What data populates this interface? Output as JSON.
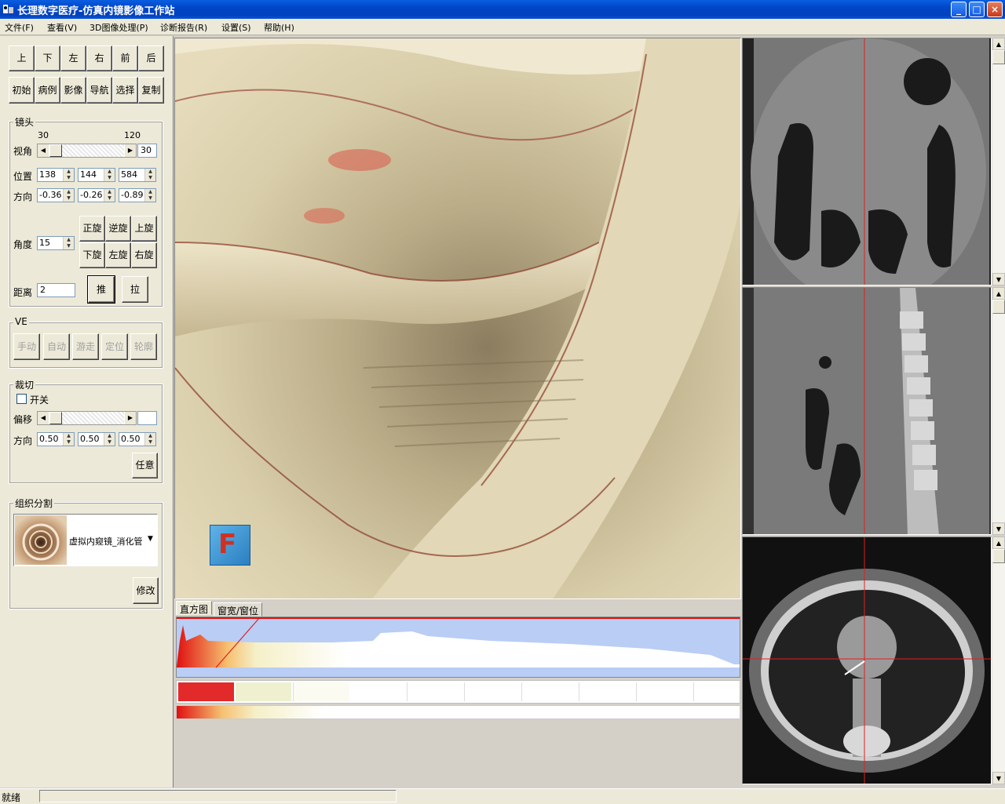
{
  "window": {
    "title": "长理数字医疗-仿真内镜影像工作站",
    "min": "_",
    "max": "□",
    "close": "×"
  },
  "menu": [
    "文件(F)",
    "查看(V)",
    "3D图像处理(P)",
    "诊断报告(R)",
    "设置(S)",
    "帮助(H)"
  ],
  "dir_buttons": [
    "上",
    "下",
    "左",
    "右",
    "前",
    "后"
  ],
  "action_buttons": [
    "初始",
    "病例",
    "影像",
    "导航",
    "选择",
    "复制"
  ],
  "lens": {
    "title": "镜头",
    "fov_min": "30",
    "fov_max": "120",
    "fov_label": "视角",
    "fov_value": "30",
    "pos_label": "位置",
    "pos": [
      "138",
      "144",
      "584"
    ],
    "dir_label": "方向",
    "dir": [
      "-0.36",
      "-0.26",
      "-0.89"
    ],
    "angle_label": "角度",
    "angle_value": "15",
    "rot_buttons": [
      "正旋",
      "逆旋",
      "上旋",
      "下旋",
      "左旋",
      "右旋"
    ],
    "dist_label": "距离",
    "dist_value": "2",
    "push": "推",
    "pull": "拉"
  },
  "ve": {
    "title": "VE",
    "buttons": [
      "手动",
      "自动",
      "游走",
      "定位",
      "轮廓"
    ]
  },
  "clip": {
    "title": "裁切",
    "switch_label": "开关",
    "offset_label": "偏移",
    "offset_value": "",
    "dir_label": "方向",
    "dir": [
      "0.50",
      "0.50",
      "0.50"
    ],
    "any": "任意"
  },
  "tissue": {
    "title": "组织分割",
    "preset": "虚拟内窥镜_消化管",
    "modify": "修改"
  },
  "tabs": [
    "直方图",
    "窗宽/窗位"
  ],
  "orientation_label": "F",
  "status": "就绪",
  "colors": {
    "accent": "#0a246a",
    "histogram_bg": "#b9cdf5",
    "transfer_red": "#e01010",
    "crosshair": "#e02020"
  }
}
